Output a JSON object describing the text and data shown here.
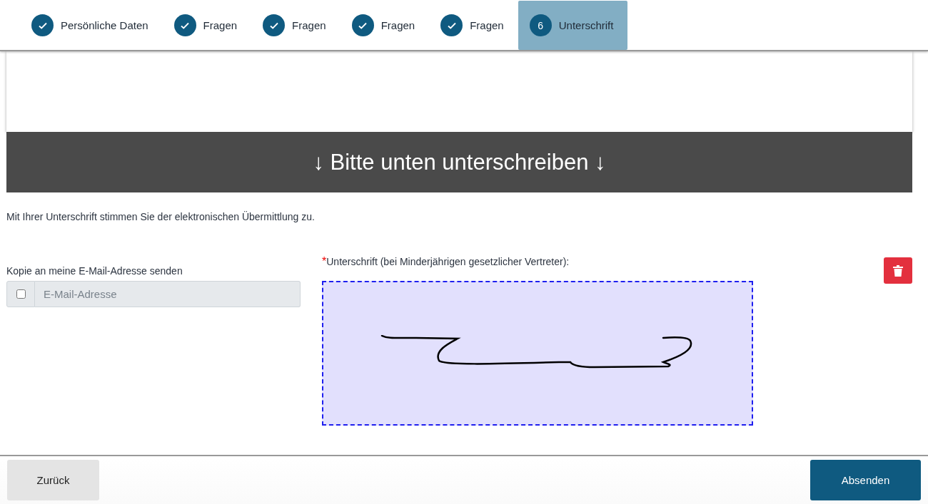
{
  "steps": [
    {
      "label": "Persönliche Daten",
      "done": true,
      "selected": false
    },
    {
      "label": "Fragen",
      "done": true,
      "selected": false
    },
    {
      "label": "Fragen",
      "done": true,
      "selected": false
    },
    {
      "label": "Fragen",
      "done": true,
      "selected": false
    },
    {
      "label": "Fragen",
      "done": true,
      "selected": false
    },
    {
      "label": "Unterschrift",
      "number": "6",
      "done": false,
      "selected": true
    }
  ],
  "banner": "↓ Bitte unten unterschreiben ↓",
  "consent_text": "Mit Ihrer Unterschrift stimmen Sie der elektronischen Übermittlung zu.",
  "email_copy": {
    "label": "Kopie an meine E-Mail-Adresse senden",
    "checked": false,
    "placeholder": "E-Mail-Adresse"
  },
  "signature": {
    "required_mark": "*",
    "label": "Unterschrift (bei Minderjährigen gesetzlicher Vertreter):"
  },
  "footer": {
    "back": "Zurück",
    "submit": "Absenden"
  }
}
